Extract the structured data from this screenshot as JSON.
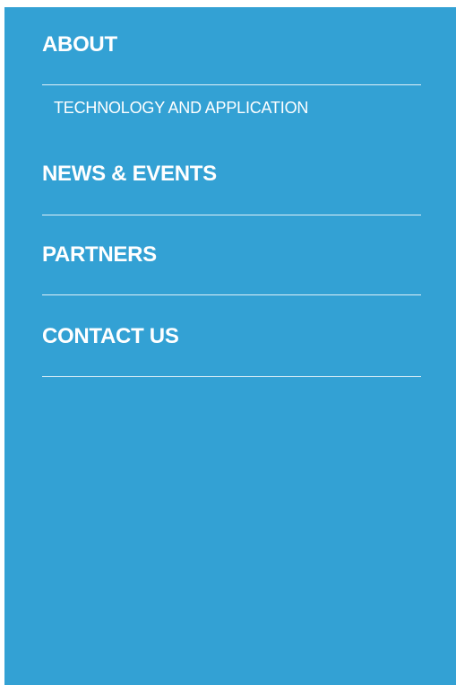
{
  "menu": {
    "items": [
      {
        "label": "ABOUT"
      },
      {
        "label": "NEWS & EVENTS"
      },
      {
        "label": "PARTNERS"
      },
      {
        "label": "CONTACT US"
      }
    ],
    "submenu": {
      "about": [
        {
          "label": "TECHNOLOGY AND APPLICATION"
        }
      ]
    }
  },
  "colors": {
    "panel_background": "#33a1d4",
    "text": "#ffffff",
    "divider": "#ffffff"
  }
}
